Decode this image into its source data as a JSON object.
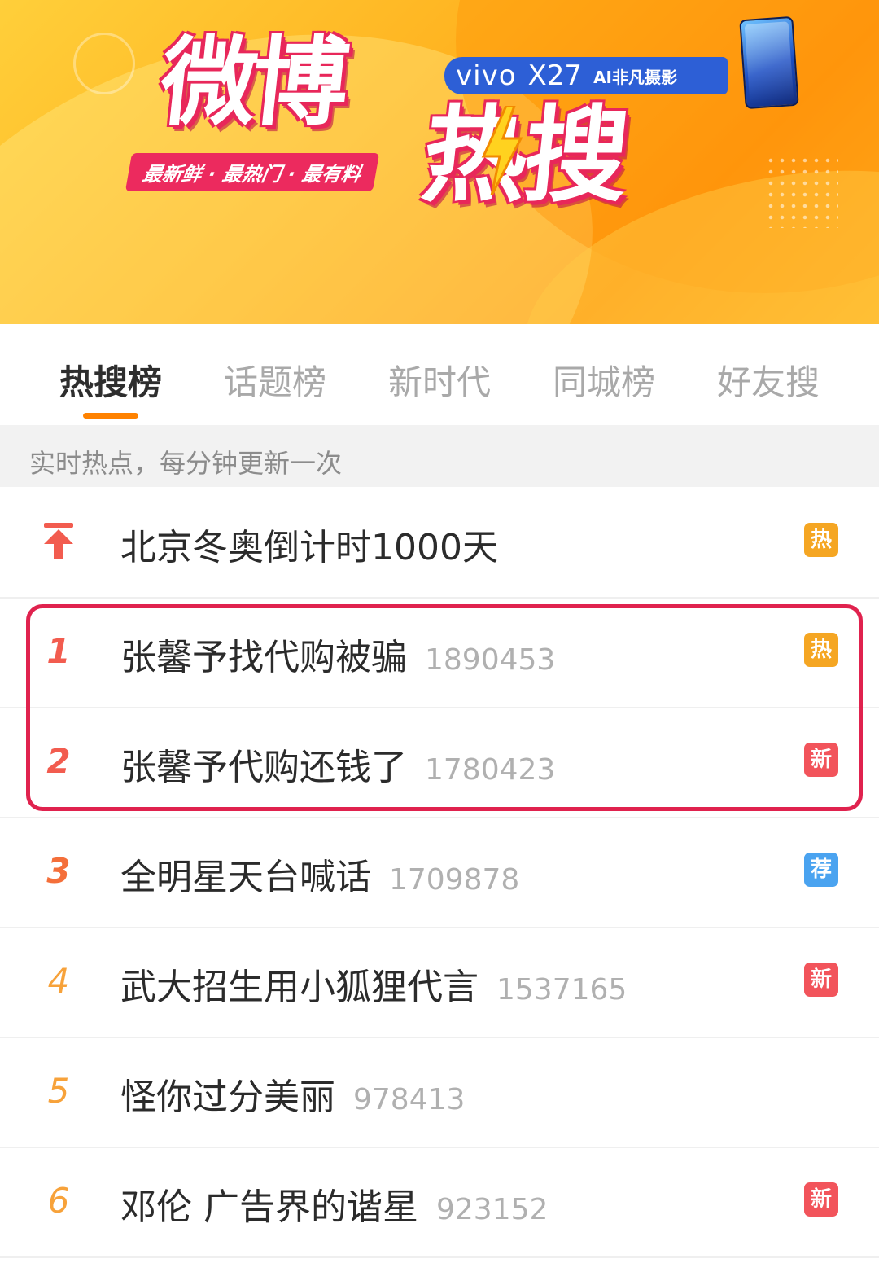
{
  "banner": {
    "logo_title": "微博",
    "logo_subtitle": "热搜",
    "slogan": "最新鲜 · 最热门 · 最有料",
    "ad_brand": "vivo",
    "ad_model": "X27",
    "ad_slogan": "AI非凡摄影"
  },
  "tabs": [
    {
      "label": "热搜榜",
      "active": true
    },
    {
      "label": "话题榜",
      "active": false
    },
    {
      "label": "新时代",
      "active": false
    },
    {
      "label": "同城榜",
      "active": false
    },
    {
      "label": "好友搜",
      "active": false
    }
  ],
  "notice": "实时热点，每分钟更新一次",
  "pinned": {
    "title": "北京冬奥倒计时1000天",
    "badge": "热",
    "badge_color": "#f5a623"
  },
  "items": [
    {
      "rank": "1",
      "title": "张馨予找代购被骗",
      "count": "1890453",
      "badge": "热",
      "badge_color": "#f5a623"
    },
    {
      "rank": "2",
      "title": "张馨予代购还钱了",
      "count": "1780423",
      "badge": "新",
      "badge_color": "#f2545b"
    },
    {
      "rank": "3",
      "title": "全明星天台喊话",
      "count": "1709878",
      "badge": "荐",
      "badge_color": "#4aa3f0"
    },
    {
      "rank": "4",
      "title": "武大招生用小狐狸代言",
      "count": "1537165",
      "badge": "新",
      "badge_color": "#f2545b"
    },
    {
      "rank": "5",
      "title": "怪你过分美丽",
      "count": "978413",
      "badge": "",
      "badge_color": ""
    },
    {
      "rank": "6",
      "title": "邓伦 广告界的谐星",
      "count": "923152",
      "badge": "新",
      "badge_color": "#f2545b"
    }
  ],
  "colors": {
    "accent": "#ff8200",
    "highlight_border": "#e0224e",
    "banner_orange": "#ffb21f",
    "logo_pink": "#e8275a"
  }
}
